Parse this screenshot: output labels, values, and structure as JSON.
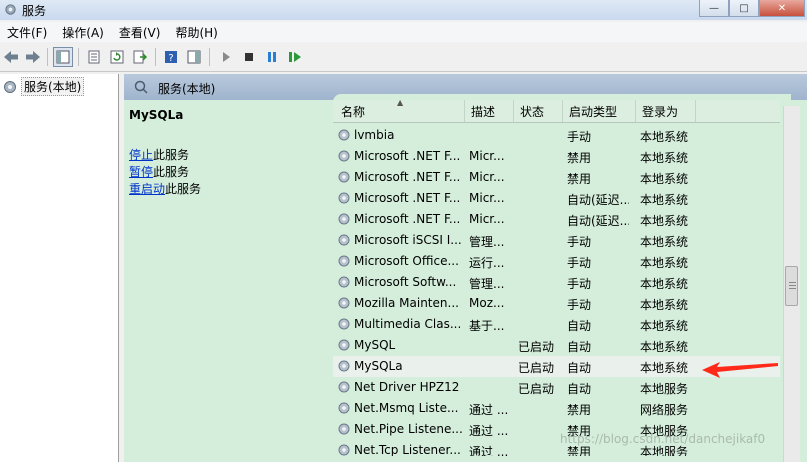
{
  "window": {
    "title": "服务"
  },
  "menu": [
    "文件(F)",
    "操作(A)",
    "查看(V)",
    "帮助(H)"
  ],
  "tree": {
    "root_label": "服务(本地)"
  },
  "header": {
    "title": "服务(本地)"
  },
  "details": {
    "service_name": "MySQLa",
    "actions": [
      {
        "link": "停止",
        "rest": "此服务"
      },
      {
        "link": "暂停",
        "rest": "此服务"
      },
      {
        "link": "重启动",
        "rest": "此服务"
      }
    ]
  },
  "columns": [
    "名称",
    "描述",
    "状态",
    "启动类型",
    "登录为"
  ],
  "services": [
    {
      "name": "lvmbia",
      "desc": "",
      "status": "",
      "startup": "手动",
      "logon": "本地系统"
    },
    {
      "name": "Microsoft .NET F...",
      "desc": "Micr...",
      "status": "",
      "startup": "禁用",
      "logon": "本地系统"
    },
    {
      "name": "Microsoft .NET F...",
      "desc": "Micr...",
      "status": "",
      "startup": "禁用",
      "logon": "本地系统"
    },
    {
      "name": "Microsoft .NET F...",
      "desc": "Micr...",
      "status": "",
      "startup": "自动(延迟...",
      "logon": "本地系统"
    },
    {
      "name": "Microsoft .NET F...",
      "desc": "Micr...",
      "status": "",
      "startup": "自动(延迟...",
      "logon": "本地系统"
    },
    {
      "name": "Microsoft iSCSI I...",
      "desc": "管理...",
      "status": "",
      "startup": "手动",
      "logon": "本地系统"
    },
    {
      "name": "Microsoft Office...",
      "desc": "运行...",
      "status": "",
      "startup": "手动",
      "logon": "本地系统"
    },
    {
      "name": "Microsoft Softw...",
      "desc": "管理...",
      "status": "",
      "startup": "手动",
      "logon": "本地系统"
    },
    {
      "name": "Mozilla Mainten...",
      "desc": "Moz...",
      "status": "",
      "startup": "手动",
      "logon": "本地系统"
    },
    {
      "name": "Multimedia Clas...",
      "desc": "基于...",
      "status": "",
      "startup": "自动",
      "logon": "本地系统"
    },
    {
      "name": "MySQL",
      "desc": "",
      "status": "已启动",
      "startup": "自动",
      "logon": "本地系统"
    },
    {
      "name": "MySQLa",
      "desc": "",
      "status": "已启动",
      "startup": "自动",
      "logon": "本地系统"
    },
    {
      "name": "Net Driver HPZ12",
      "desc": "",
      "status": "已启动",
      "startup": "自动",
      "logon": "本地服务"
    },
    {
      "name": "Net.Msmq Liste...",
      "desc": "通过 ...",
      "status": "",
      "startup": "禁用",
      "logon": "网络服务"
    },
    {
      "name": "Net.Pipe Listene...",
      "desc": "通过 ...",
      "status": "",
      "startup": "禁用",
      "logon": "本地服务"
    },
    {
      "name": "Net.Tcp Listener...",
      "desc": "通过 ...",
      "status": "",
      "startup": "禁用",
      "logon": "本地服务"
    }
  ],
  "selected_service": "MySQLa",
  "watermark": "https://blog.csdn.net/danchejikaf0",
  "colors": {
    "pane_green": "#d5eedb",
    "link_blue": "#0033cc",
    "arrow_red": "#ff2a1a"
  }
}
